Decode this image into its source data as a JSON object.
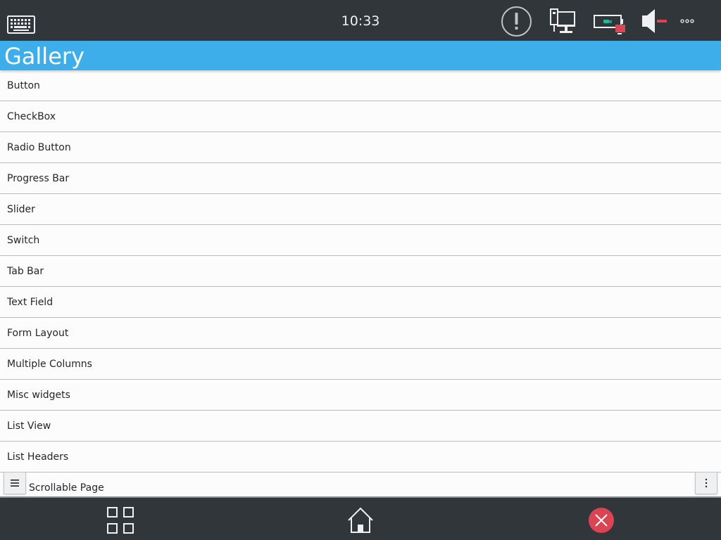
{
  "status_bar": {
    "time": "10:33",
    "icons": [
      "virtual-keyboard-icon",
      "notification-alert-icon",
      "network-wired-icon",
      "battery-charging-icon",
      "volume-muted-icon",
      "more-icon"
    ]
  },
  "header": {
    "title": "Gallery"
  },
  "list": {
    "items": [
      {
        "label": "Button"
      },
      {
        "label": "CheckBox"
      },
      {
        "label": "Radio Button"
      },
      {
        "label": "Progress Bar"
      },
      {
        "label": "Slider"
      },
      {
        "label": "Switch"
      },
      {
        "label": "Tab Bar"
      },
      {
        "label": "Text Field"
      },
      {
        "label": "Form Layout"
      },
      {
        "label": "Multiple Columns"
      },
      {
        "label": "Misc widgets"
      },
      {
        "label": "List View"
      },
      {
        "label": "List Headers"
      },
      {
        "label": "Scrollable Page"
      }
    ]
  },
  "navigation": {
    "icons": [
      "app-grid-icon",
      "home-icon",
      "close-icon"
    ]
  },
  "colors": {
    "panel": "#31363b",
    "accent": "#3daee9",
    "list_background": "#fcfcfc",
    "separator": "#b9bcbe",
    "text": "#232629",
    "close_red": "#da4453",
    "status_green": "#1abc9c"
  }
}
